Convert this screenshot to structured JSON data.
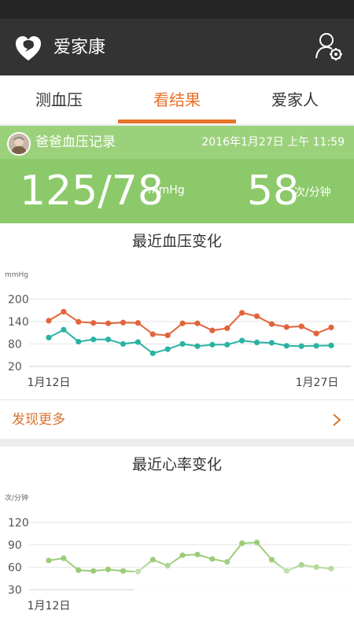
{
  "app": {
    "title": "爱家康"
  },
  "tabs": [
    {
      "label": "测血压"
    },
    {
      "label": "看结果"
    },
    {
      "label": "爱家人"
    }
  ],
  "summary": {
    "record_title": "爸爸血压记录",
    "timestamp": "2016年1月27日 上午 11:59",
    "blood_pressure": "125/78",
    "bp_unit": "mmHg",
    "heart_rate": "58",
    "hr_unit": "次/分钟"
  },
  "bp_card": {
    "title": "最近血压变化",
    "more_label": "发现更多"
  },
  "hr_card": {
    "title": "最近心率变化"
  },
  "colors": {
    "accent": "#e8732a",
    "green": "#8cc96a",
    "systolic": "#e2643a",
    "diastolic": "#2bb3a3",
    "heart_rate": "#9ccc7a"
  },
  "chart_data": [
    {
      "type": "line",
      "title": "最近血压变化",
      "ylabel": "mmHg",
      "yticks": [
        20,
        80,
        140,
        200
      ],
      "ylim": [
        20,
        230
      ],
      "xlabels": [
        "1月12日",
        "1月27日"
      ],
      "series": [
        {
          "values": [
            142,
            166,
            139,
            136,
            135,
            137,
            136,
            106,
            103,
            135,
            135,
            116,
            122,
            163,
            154,
            133,
            125,
            127,
            108,
            124
          ]
        },
        {
          "values": [
            97,
            118,
            86,
            92,
            92,
            80,
            85,
            55,
            66,
            80,
            74,
            78,
            78,
            89,
            84,
            83,
            75,
            74,
            75,
            76
          ]
        }
      ]
    },
    {
      "type": "line",
      "title": "最近心率变化",
      "ylabel": "次/分钟",
      "yticks": [
        30,
        60,
        90,
        120
      ],
      "ylim": [
        30,
        135
      ],
      "xlabels": [
        "1月12日"
      ],
      "series": [
        {
          "values": [
            69,
            72,
            56,
            55,
            57,
            55,
            54,
            70,
            62,
            76,
            77,
            71,
            67,
            92,
            93,
            70,
            55,
            63,
            60,
            58
          ]
        }
      ]
    }
  ]
}
